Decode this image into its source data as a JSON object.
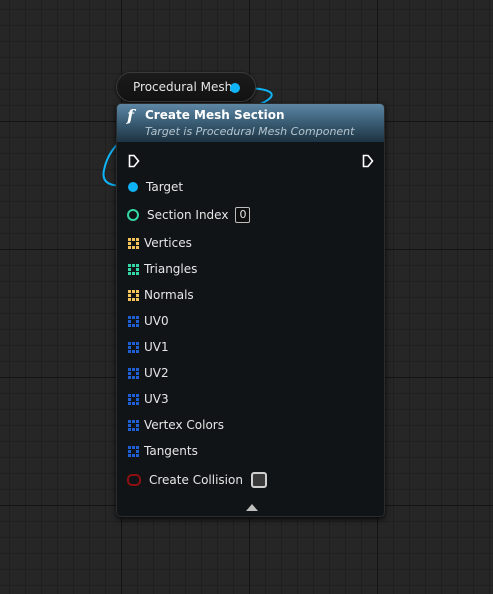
{
  "variable_node": {
    "label": "Procedural Mesh",
    "pin_color": "#0fb4f7"
  },
  "function_node": {
    "icon": "f",
    "title": "Create Mesh Section",
    "subtitle": "Target is Procedural Mesh Component",
    "header_color": "#3c6078",
    "collapse_icon": "collapse-arrow-icon",
    "pins": {
      "target": {
        "label": "Target",
        "type": "object",
        "color": "#0fb4f7"
      },
      "section_index": {
        "label": "Section Index",
        "type": "integer",
        "value": "0",
        "color": "#33d7a8"
      },
      "vertices": {
        "label": "Vertices",
        "type": "vector-array",
        "color": "#f4c45a"
      },
      "triangles": {
        "label": "Triangles",
        "type": "integer-array",
        "color": "#33d7a8"
      },
      "normals": {
        "label": "Normals",
        "type": "vector-array",
        "color": "#f4c45a"
      },
      "uv0": {
        "label": "UV0",
        "type": "struct-array",
        "color": "#1e5fd6"
      },
      "uv1": {
        "label": "UV1",
        "type": "struct-array",
        "color": "#1e5fd6"
      },
      "uv2": {
        "label": "UV2",
        "type": "struct-array",
        "color": "#1e5fd6"
      },
      "uv3": {
        "label": "UV3",
        "type": "struct-array",
        "color": "#1e5fd6"
      },
      "vertex_colors": {
        "label": "Vertex Colors",
        "type": "struct-array",
        "color": "#1e5fd6"
      },
      "tangents": {
        "label": "Tangents",
        "type": "struct-array",
        "color": "#1e5fd6"
      },
      "create_collision": {
        "label": "Create Collision",
        "type": "boolean",
        "checked": false,
        "color": "#8c0f12"
      }
    }
  }
}
